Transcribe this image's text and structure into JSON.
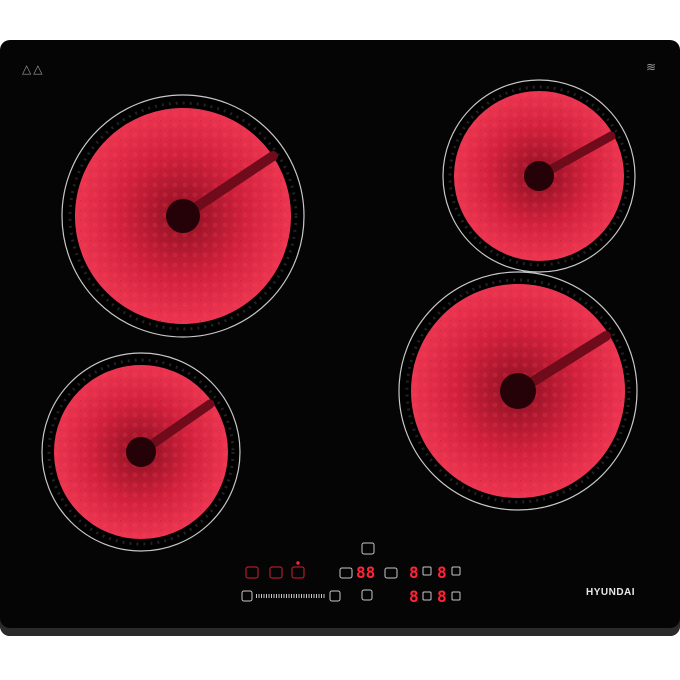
{
  "brand": "HYUNDAI",
  "icons": {
    "warning": "warning-triangle-icons",
    "heat": "residual-heat-icon",
    "lock": "lock-icon",
    "timer": "timer-icon",
    "power": "power-icon",
    "minus": "minus-icon",
    "plus": "plus-icon"
  },
  "display": {
    "timer_value": "88",
    "zone_front_left": "8",
    "zone_front_right": "8",
    "zone_rear_left": "8",
    "zone_rear_right": "8"
  },
  "colors": {
    "glass": "#050505",
    "glow": "#c41f3a",
    "glow_dark": "#6d0c1c",
    "led": "#ff2437",
    "control_outline": "#d51f33"
  }
}
